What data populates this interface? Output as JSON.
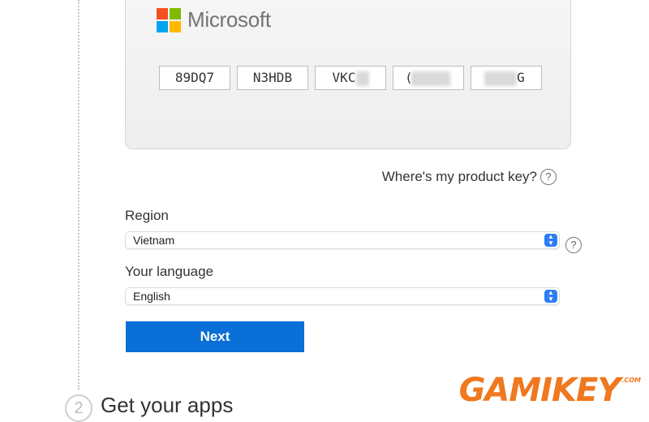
{
  "brand": {
    "logo_text": "Microsoft",
    "logo_colors": [
      "#f25022",
      "#7fba00",
      "#00a4ef",
      "#ffb900"
    ]
  },
  "product_key": {
    "segments": [
      "89DQ7",
      "N3HDB",
      "VKC",
      "(",
      "G"
    ]
  },
  "help_link": {
    "label": "Where's my product key?",
    "icon": "question-circle-icon"
  },
  "region": {
    "label": "Region",
    "selected": "Vietnam",
    "help_icon": "question-circle-icon"
  },
  "language": {
    "label": "Your language",
    "selected": "English"
  },
  "next_button": {
    "label": "Next",
    "color": "#0a6fd6"
  },
  "next_step": {
    "number": "2",
    "title": "Get your apps"
  },
  "watermark": {
    "text": "GAMIKEY",
    "suffix": ".COM",
    "color": "#f0781f"
  }
}
